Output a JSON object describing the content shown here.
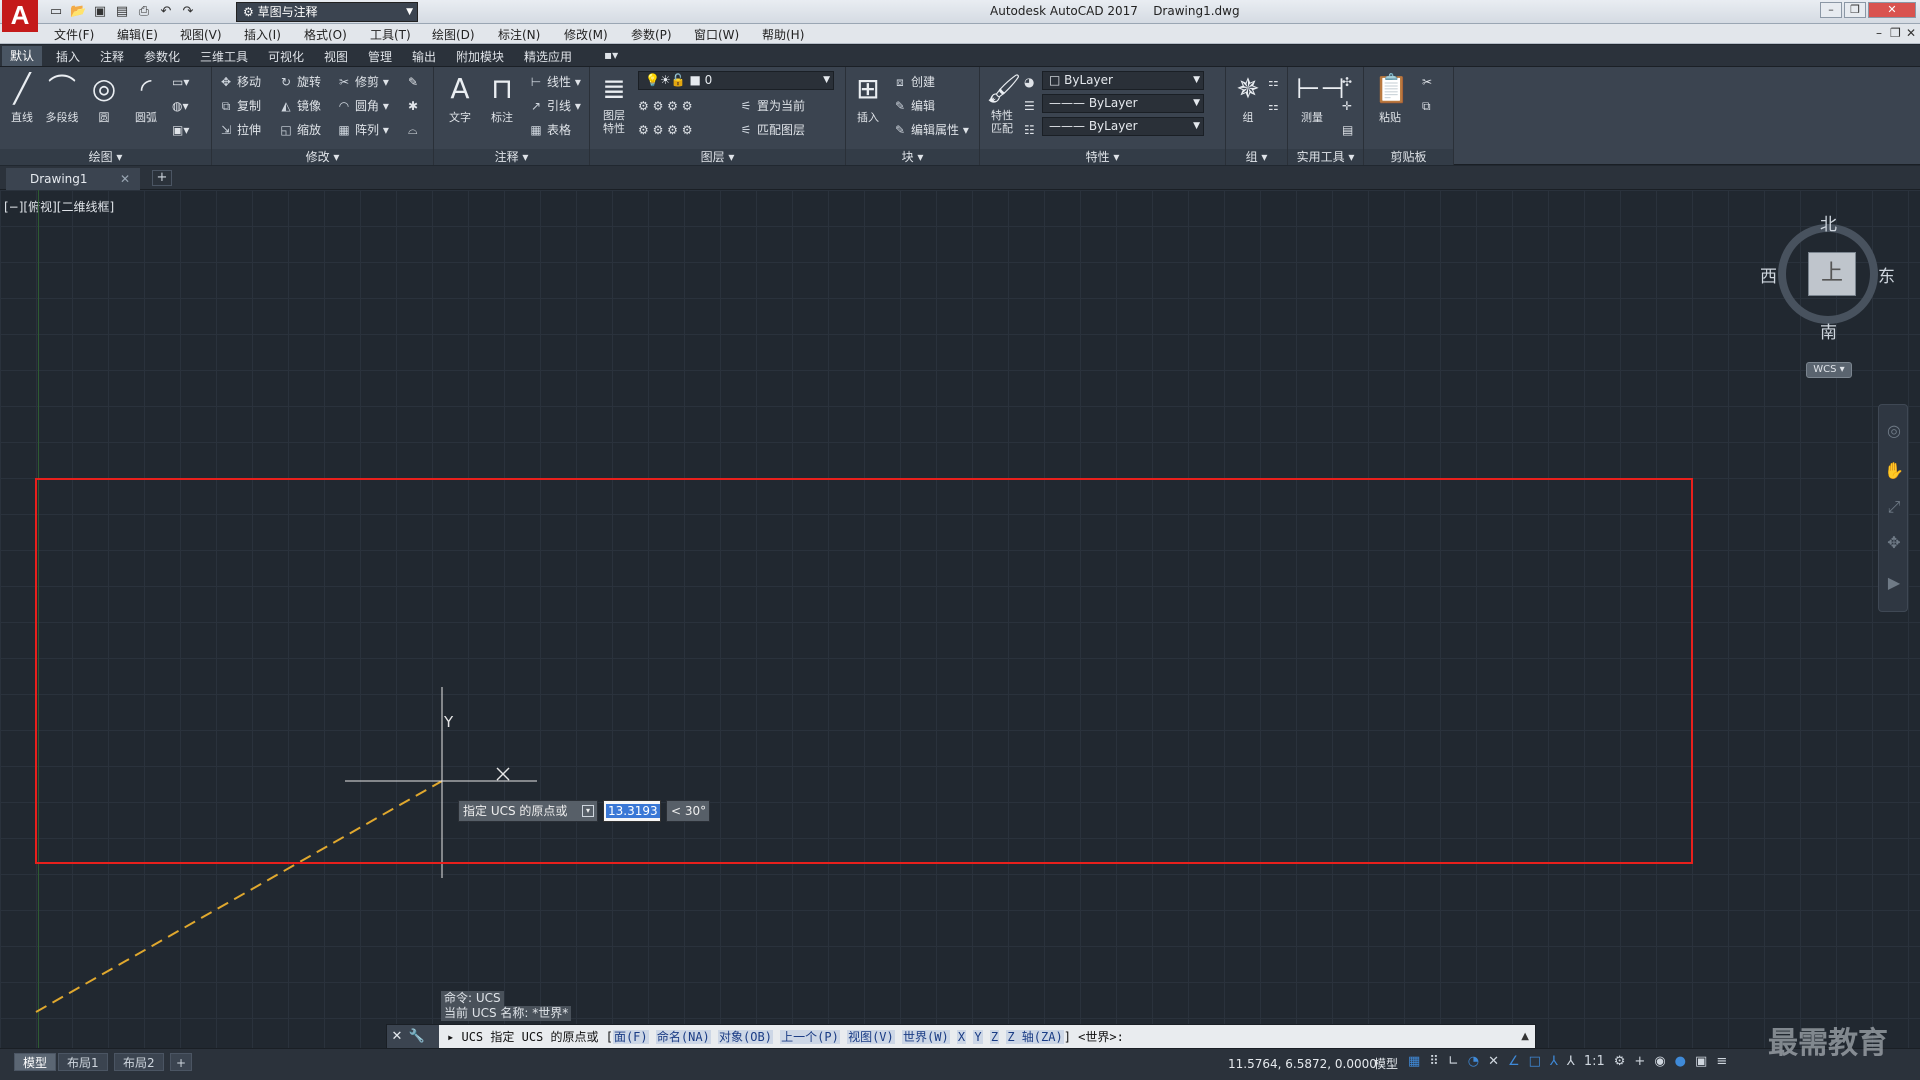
{
  "titlebar": {
    "app_title": "Autodesk AutoCAD 2017",
    "doc_title": "Drawing1.dwg",
    "workspace": "草图与注释",
    "logo": "A"
  },
  "menu": [
    "文件(F)",
    "编辑(E)",
    "视图(V)",
    "插入(I)",
    "格式(O)",
    "工具(T)",
    "绘图(D)",
    "标注(N)",
    "修改(M)",
    "参数(P)",
    "窗口(W)",
    "帮助(H)"
  ],
  "ribbon_tabs": [
    "默认",
    "插入",
    "注释",
    "参数化",
    "三维工具",
    "可视化",
    "视图",
    "管理",
    "输出",
    "附加模块",
    "精选应用"
  ],
  "ribbon": {
    "draw": {
      "label": "绘图",
      "line": "直线",
      "polyline": "多段线",
      "circle": "圆",
      "arc": "圆弧"
    },
    "modify": {
      "label": "修改",
      "move": "移动",
      "rotate": "旋转",
      "trim": "修剪",
      "copy": "复制",
      "mirror": "镜像",
      "fillet": "圆角",
      "stretch": "拉伸",
      "scale": "缩放",
      "array": "阵列"
    },
    "annotation": {
      "label": "注释",
      "text": "文字",
      "dim": "标注",
      "linear": "线性",
      "leader": "引线",
      "table": "表格"
    },
    "layers": {
      "label": "图层",
      "props": "图层\n特性",
      "layer_combo": "0",
      "set_current": "置为当前",
      "match_layer": "匹配图层"
    },
    "block": {
      "label": "块",
      "insert": "插入",
      "create": "创建",
      "edit": "编辑",
      "edit_attr": "编辑属性"
    },
    "properties": {
      "label": "特性",
      "match": "特性\n匹配",
      "color": "ByLayer",
      "linetype": "ByLayer",
      "lineweight": "ByLayer"
    },
    "groups": {
      "label": "组",
      "group": "组"
    },
    "utilities": {
      "label": "实用工具",
      "measure": "测量"
    },
    "clipboard": {
      "label": "剪贴板",
      "paste": "粘贴"
    }
  },
  "doc_tab": "Drawing1",
  "viewport": {
    "label": "[−][俯视][二维线框]",
    "north": "北",
    "south": "南",
    "east": "东",
    "west": "西",
    "top": "上",
    "wcs": "WCS"
  },
  "crosshair": {
    "y_label": "Y"
  },
  "dynamic_input": {
    "prompt": "指定 UCS 的原点或",
    "value": "13.3193",
    "angle": "< 30°"
  },
  "history": [
    "命令: UCS",
    "当前 UCS 名称: *世界*"
  ],
  "command_line": {
    "prefix": "UCS 指定 UCS 的原点或 [",
    "options": [
      "面(F)",
      "命名(NA)",
      "对象(OB)",
      "上一个(P)",
      "视图(V)",
      "世界(W)",
      "X",
      "Y",
      "Z",
      "Z 轴(ZA)"
    ],
    "suffix": "] <世界>:"
  },
  "status": {
    "layouts": [
      "模型",
      "布局1",
      "布局2"
    ],
    "coords": "11.5764, 6.5872, 0.0000",
    "mode": "模型",
    "scale": "1:1"
  },
  "watermark": "最需教育",
  "colors": {
    "accent": "#3a78d6",
    "highlight_box": "#e8201c",
    "background": "#212830"
  }
}
